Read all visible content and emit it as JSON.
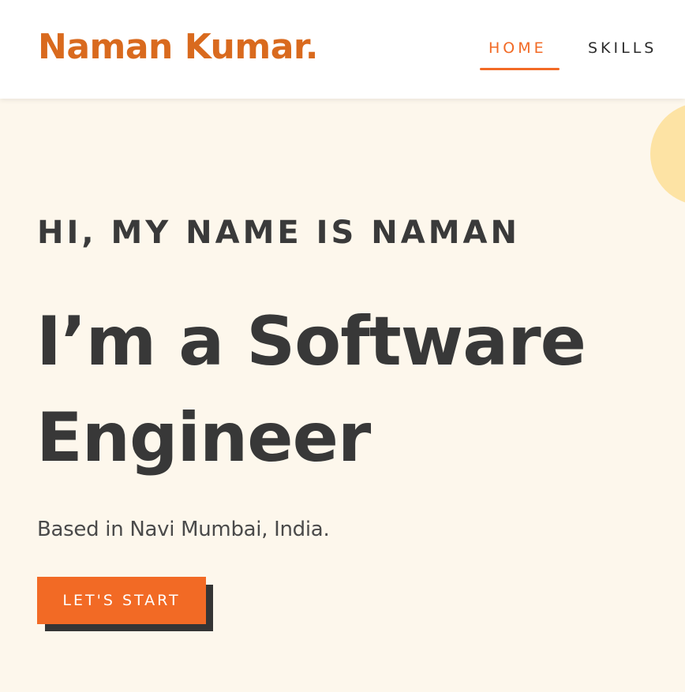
{
  "header": {
    "brand": "Naman Kumar.",
    "nav": {
      "home": "HOME",
      "skills": "SKILLS"
    }
  },
  "hero": {
    "greeting": "HI, MY NAME IS NAMAN",
    "headline_line1": "I’m a Software",
    "headline_line2": "Engineer",
    "location": "Based in Navi Mumbai, India.",
    "cta_label": "LET'S START"
  },
  "colors": {
    "accent": "#f26a25",
    "brand": "#d96a1e",
    "background": "#fdf7ec",
    "blob": "#fde3a4",
    "text_dark": "#383838"
  }
}
